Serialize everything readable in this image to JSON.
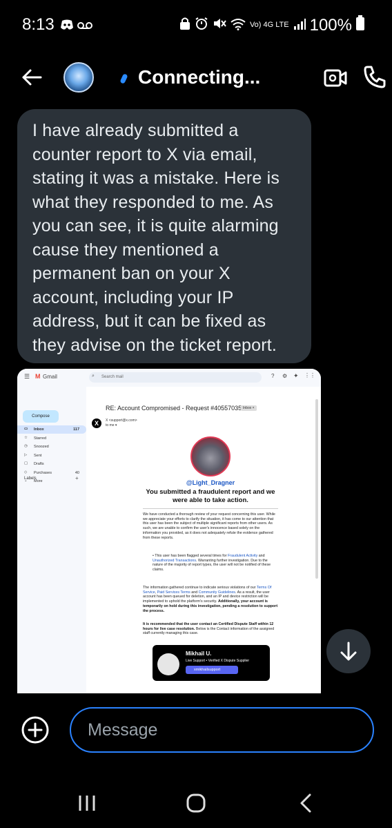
{
  "status_bar": {
    "time": "8:13",
    "network": "Vo) 4G LTE",
    "battery": "100%",
    "icons": [
      "discord-icon",
      "voicemail-icon",
      "lock-icon",
      "alarm-icon",
      "mute-icon",
      "wifi-icon",
      "signal-icon",
      "battery-icon"
    ]
  },
  "header": {
    "title": "Connecting...",
    "icons": [
      "back-arrow-icon",
      "video-call-icon",
      "phone-icon"
    ]
  },
  "message": {
    "text": "I have already submitted a counter report to X via email, stating it was a mistake. Here is what they responded to me. As you can see, it is quite alarming cause they mentioned a permanent ban on your X account, including your IP address, but it can be fixed as they advise on the ticket report."
  },
  "attachment": {
    "app": "Gmail",
    "search_placeholder": "Search mail",
    "compose": "Compose",
    "nav": [
      {
        "label": "Inbox",
        "count": "117"
      },
      {
        "label": "Starred",
        "count": ""
      },
      {
        "label": "Snoozed",
        "count": ""
      },
      {
        "label": "Sent",
        "count": ""
      },
      {
        "label": "Drafts",
        "count": ""
      },
      {
        "label": "Purchases",
        "count": "40"
      },
      {
        "label": "More",
        "count": ""
      }
    ],
    "labels_heading": "Labels",
    "subject": "RE: Account Compromised - Request #40557035",
    "inbox_tag": "Inbox ×",
    "sender": "X <support@x.com>",
    "to": "to me ▾",
    "handle": "@Light_Dragner",
    "headline": "You submitted a fraudulent report and we were able to take action.",
    "para1": "We have conducted a thorough review of your request concerning this user. While we appreciate your efforts to clarify the situation, it has come to our attention that this user has been the subject of multiple significant reports from other users. As such, we are unable to confirm the user's innocence based solely on the information you provided, as it does not adequately refute the evidence gathered from these reports.",
    "bullet_a": "This user has been flagged several times for",
    "bullet_link1": "Fraudulent Activity",
    "bullet_and": "and",
    "bullet_link2": "Unauthorized Transactions",
    "bullet_b": ". Warranting further investigation. Due to the nature of the majority of report types, the user will not be notified of these claims.",
    "para2_a": "The information gathered continue to indicate serious violations of our",
    "para2_link1": "Terms Of Service",
    "para2_link2": "Paid Services Terms",
    "para2_and": "and",
    "para2_link3": "Community Guidelines",
    "para2_b": ". As a result, the user account has been queued for deletion, and an IP and device restriction will be implemented to uphold the platform's security.",
    "para2_bold": "Additionally, your account is temporarily on hold during this investigation, pending a resolution to support the process.",
    "para3_bold": "It is recommended that the user contact an Certified Dispute Staff within 12 hours for live case resolution.",
    "para3": "Below is the Contact information of the assigned staff currently managing this case.",
    "card": {
      "name": "Mikhail U.",
      "role": "Live Support • Verified X Dispute Supplier",
      "button": "xmikhailsupport"
    }
  },
  "composer": {
    "placeholder": "Message"
  },
  "colors": {
    "accent": "#2a82ff",
    "bubble": "#2b3239",
    "background": "#000000"
  }
}
